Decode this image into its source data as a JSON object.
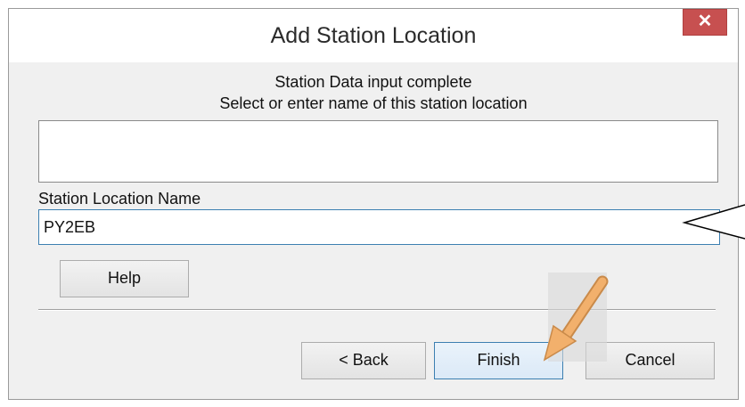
{
  "dialog": {
    "title": "Add Station Location",
    "close_glyph": "✕",
    "message_line1": "Station Data input complete",
    "message_line2": "Select or enter name of this station location"
  },
  "station_list": {
    "items": []
  },
  "name_field": {
    "label": "Station Location Name",
    "value": "PY2EB"
  },
  "buttons": {
    "help": "Help",
    "back": "< Back",
    "finish": "Finish",
    "cancel": "Cancel"
  },
  "annotations": {
    "pointer_arrow_color": "#f2b06c",
    "callout_color": "#000000"
  }
}
